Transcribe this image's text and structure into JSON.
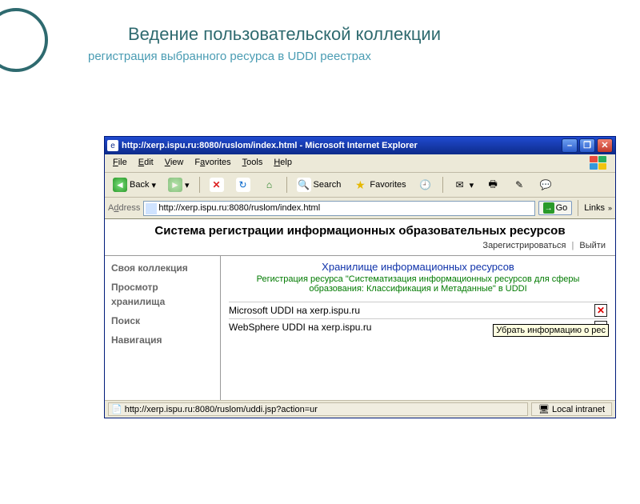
{
  "slide": {
    "title": "Ведение пользовательской коллекции",
    "subtitle": "регистрация выбранного ресурса в UDDI реестрах"
  },
  "titlebar": {
    "text": "http://xerp.ispu.ru:8080/ruslom/index.html - Microsoft Internet Explorer"
  },
  "menu": {
    "file": "File",
    "edit": "Edit",
    "view": "View",
    "favorites": "Favorites",
    "tools": "Tools",
    "help": "Help"
  },
  "toolbar": {
    "back": "Back",
    "search": "Search",
    "favorites": "Favorites"
  },
  "address": {
    "label": "Address",
    "value": "http://xerp.ispu.ru:8080/ruslom/index.html",
    "go": "Go",
    "links": "Links"
  },
  "page": {
    "heading": "Система регистрации информационных образовательных ресурсов",
    "auth_register": "Зарегистрироваться",
    "auth_logout": "Выйти"
  },
  "sidebar": {
    "items": [
      {
        "label": "Своя коллекция"
      },
      {
        "label": "Просмотр хранилища"
      },
      {
        "label": "Поиск"
      },
      {
        "label": "Навигация"
      }
    ]
  },
  "main": {
    "heading": "Хранилище информационных ресурсов",
    "reg_prefix": "Регистрация ресурса \"",
    "reg_resource": "Систематизация информационных ресурсов для сферы образования: Классификация и Метаданные",
    "reg_suffix": "\" в UDDI",
    "registries": [
      {
        "label": "Microsoft UDDI на xerp.ispu.ru",
        "state": "del"
      },
      {
        "label": "WebSphere UDDI на xerp.ispu.ru",
        "state": "add"
      }
    ],
    "tooltip": "Убрать информацию о рес"
  },
  "status": {
    "url": "http://xerp.ispu.ru:8080/ruslom/uddi.jsp?action=ur",
    "zone": "Local intranet"
  }
}
